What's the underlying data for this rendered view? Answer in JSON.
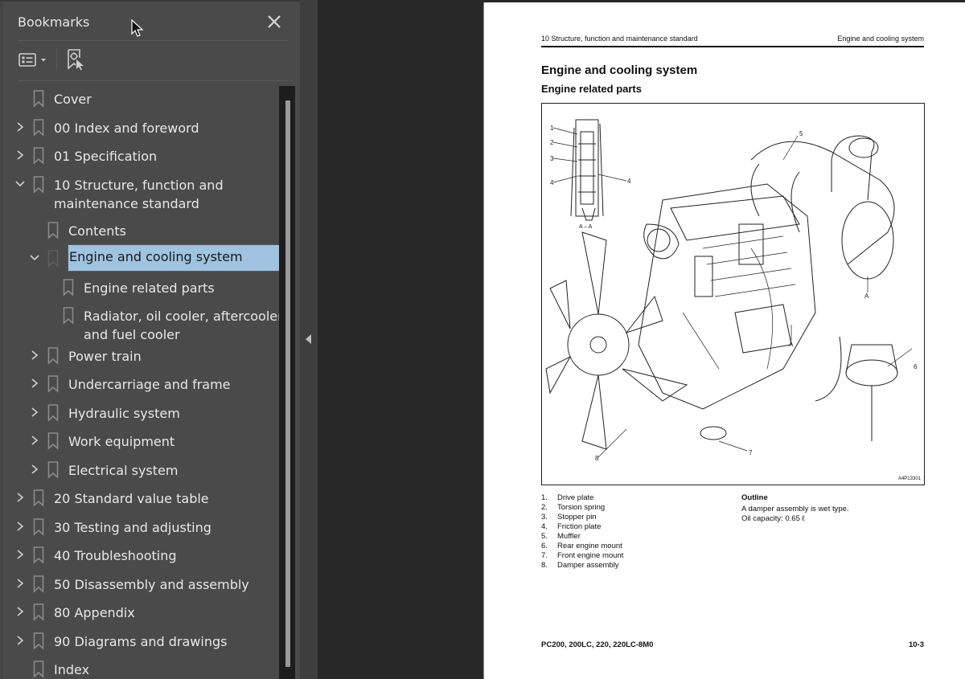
{
  "sidebar": {
    "title": "Bookmarks",
    "close_label": "close",
    "toolbar": {
      "options_icon": "list-options-icon",
      "find_bookmark_icon": "find-current-bookmark-icon"
    },
    "items": [
      {
        "label": "Cover",
        "level": 0,
        "expander": "none"
      },
      {
        "label": "00 Index and foreword",
        "level": 0,
        "expander": "collapsed"
      },
      {
        "label": "01 Specification",
        "level": 0,
        "expander": "collapsed"
      },
      {
        "label": "10 Structure, function and maintenance standard",
        "level": 0,
        "expander": "expanded"
      },
      {
        "label": "Contents",
        "level": 1,
        "expander": "none"
      },
      {
        "label": "Engine and cooling system",
        "level": 1,
        "expander": "expanded",
        "selected": true
      },
      {
        "label": "Engine related parts",
        "level": 2,
        "expander": "none"
      },
      {
        "label": "Radiator, oil cooler, aftercooler and fuel cooler",
        "level": 2,
        "expander": "none"
      },
      {
        "label": "Power train",
        "level": 1,
        "expander": "collapsed"
      },
      {
        "label": "Undercarriage and frame",
        "level": 1,
        "expander": "collapsed"
      },
      {
        "label": "Hydraulic system",
        "level": 1,
        "expander": "collapsed"
      },
      {
        "label": "Work equipment",
        "level": 1,
        "expander": "collapsed"
      },
      {
        "label": "Electrical system",
        "level": 1,
        "expander": "collapsed"
      },
      {
        "label": "20 Standard value table",
        "level": 0,
        "expander": "collapsed"
      },
      {
        "label": "30 Testing and adjusting",
        "level": 0,
        "expander": "collapsed"
      },
      {
        "label": "40 Troubleshooting",
        "level": 0,
        "expander": "collapsed"
      },
      {
        "label": "50 Disassembly and assembly",
        "level": 0,
        "expander": "collapsed"
      },
      {
        "label": "80 Appendix",
        "level": 0,
        "expander": "collapsed"
      },
      {
        "label": "90 Diagrams and drawings",
        "level": 0,
        "expander": "collapsed"
      },
      {
        "label": "Index",
        "level": 0,
        "expander": "none"
      }
    ]
  },
  "colors": {
    "sidebar_bg": "#4a4a4a",
    "viewer_bg": "#282828",
    "selection_bg": "#9fc3e0",
    "text": "#e8e8e8"
  },
  "page": {
    "running_head_left": "10 Structure, function and maintenance standard",
    "running_head_right": "Engine and cooling system",
    "title": "Engine and cooling system",
    "subtitle": "Engine related parts",
    "figure": {
      "code": "A4P13301",
      "inset_caption": "A – A",
      "callouts": [
        "1",
        "2",
        "3",
        "4",
        "4",
        "5",
        "6",
        "7",
        "8",
        "A",
        "A"
      ]
    },
    "parts": [
      {
        "num": "1.",
        "name": "Drive plate"
      },
      {
        "num": "2.",
        "name": "Torsion spring"
      },
      {
        "num": "3.",
        "name": "Stopper pin"
      },
      {
        "num": "4.",
        "name": "Friction plate"
      },
      {
        "num": "5.",
        "name": "Muffler"
      },
      {
        "num": "6.",
        "name": "Rear engine mount"
      },
      {
        "num": "7.",
        "name": "Front engine mount"
      },
      {
        "num": "8.",
        "name": "Damper assembly"
      }
    ],
    "outline": {
      "title": "Outline",
      "lines": [
        "A damper assembly is wet type.",
        "Oil capacity:  0.65 ℓ"
      ]
    },
    "footer_left": "PC200, 200LC, 220, 220LC-8M0",
    "footer_right": "10-3"
  }
}
